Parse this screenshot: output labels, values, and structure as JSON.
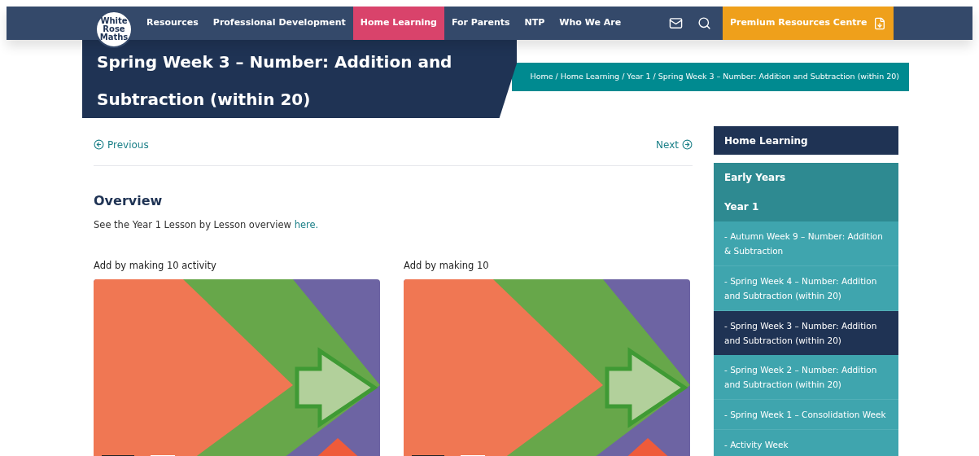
{
  "logo": {
    "lines": [
      "White",
      "Rose",
      "Maths"
    ]
  },
  "nav": [
    {
      "label": "Resources",
      "selected": false
    },
    {
      "label": "Professional Development",
      "selected": false
    },
    {
      "label": "Home Learning",
      "selected": true
    },
    {
      "label": "For Parents",
      "selected": false
    },
    {
      "label": "NTP",
      "selected": false
    },
    {
      "label": "Who We Are",
      "selected": false
    }
  ],
  "premium_button": {
    "label": "Premium Resources Centre"
  },
  "page_title": "Spring Week 3 – Number: Addition and Subtraction (within 20)",
  "breadcrumb": "Home / Home Learning / Year 1 / Spring Week 3 – Number: Addition and Subtraction (within 20)",
  "pager": {
    "previous": "Previous",
    "next": "Next"
  },
  "overview": {
    "heading": "Overview",
    "text": "See the Year 1 Lesson by Lesson overview ",
    "link": "here."
  },
  "videos": [
    {
      "caption": "Add by making 10 activity"
    },
    {
      "caption": "Add by making 10"
    }
  ],
  "sidebar": {
    "title": "Home Learning",
    "items": [
      {
        "kind": "section",
        "label": "Early Years",
        "selected": false
      },
      {
        "kind": "section",
        "label": "Year 1",
        "selected": false
      },
      {
        "kind": "link",
        "label": "- Autumn Week 9 – Number: Addition & Subtraction",
        "selected": false
      },
      {
        "kind": "link",
        "label": "- Spring Week 4 – Number: Addition and Subtraction (within 20)",
        "selected": false
      },
      {
        "kind": "link",
        "label": "- Spring Week 3 – Number: Addition and Subtraction (within 20)",
        "selected": true
      },
      {
        "kind": "link",
        "label": "- Spring Week 2 – Number: Addition and Subtraction (within 20)",
        "selected": false
      },
      {
        "kind": "link",
        "label": "- Spring Week 1 – Consolidation Week",
        "selected": false
      },
      {
        "kind": "link",
        "label": "- Activity Week",
        "selected": false
      }
    ]
  }
}
